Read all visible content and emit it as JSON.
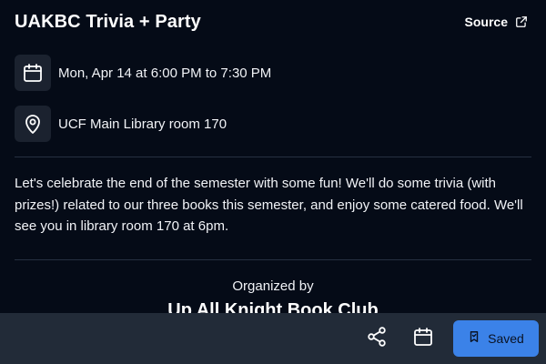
{
  "event": {
    "title": "UAKBC Trivia + Party",
    "source_label": "Source",
    "date_time": "Mon, Apr 14 at 6:00 PM to 7:30 PM",
    "location": "UCF Main Library room 170",
    "description": "Let's celebrate the end of the semester with some fun! We'll do some trivia (with prizes!) related to our three books this semester, and enjoy some catered food. We'll see you in library room 170 at 6pm.",
    "organized_by_label": "Organized by",
    "organizer": "Up All Knight Book Club"
  },
  "actions": {
    "share_icon": "share-icon",
    "calendar_icon": "calendar-icon",
    "saved_label": "Saved",
    "saved_icon": "bookmark-icon"
  },
  "colors": {
    "background": "#050b17",
    "icon_box": "#1b222f",
    "bottom_bar": "#222b38",
    "accent": "#3b82e8"
  }
}
